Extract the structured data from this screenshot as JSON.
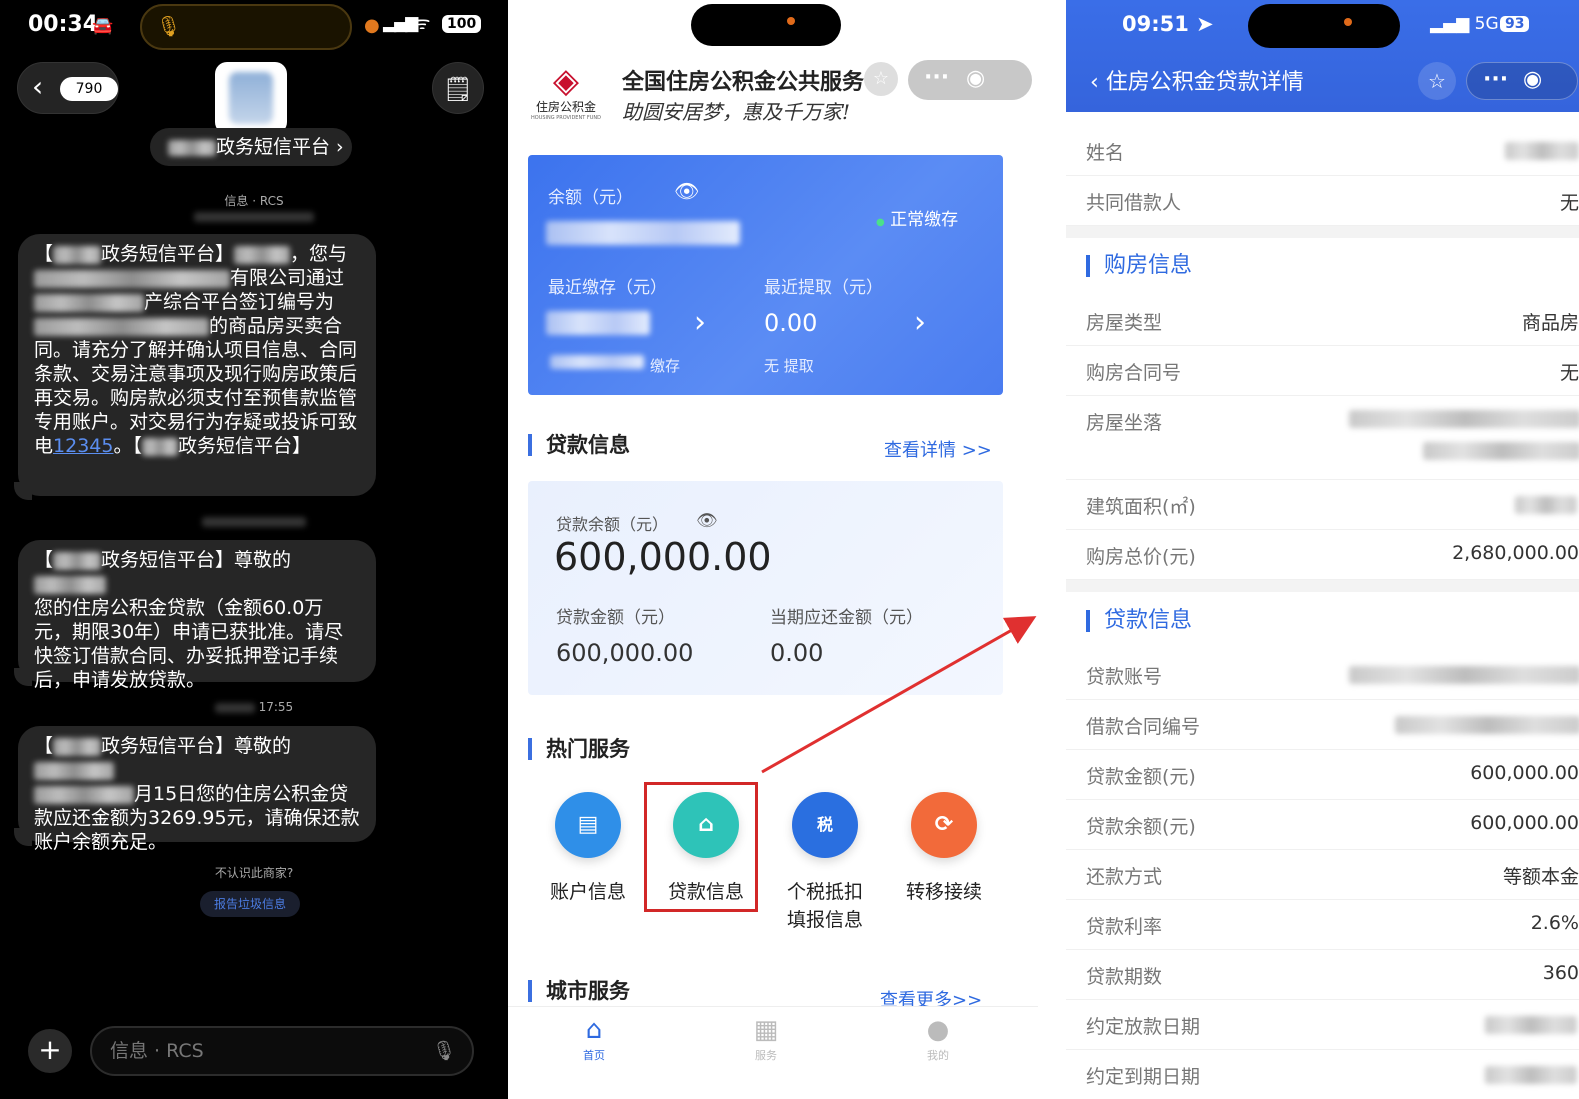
{
  "panel1": {
    "status": {
      "time": "00:34",
      "battery": "100"
    },
    "nav": {
      "back_count": "790"
    },
    "sender": {
      "name": "政务短信平台"
    },
    "meta1": "信息 · RCS",
    "msg1": {
      "p1": "【",
      "p2": "政务短信平台】",
      "p3": "，您与",
      "p4": "有限公司通过",
      "p5": "产综合平台签订编号为",
      "p6": "的商品房买卖合同。请充分了解并确认项目信息、合同条款、交易注意事项及现行购房政策后再交易。购房款必须支付至预售款监管专用账户。对交易行为存疑或投诉可致电",
      "link": "12345",
      "p7": "。【",
      "p8": "政务短信平台】"
    },
    "msg2": {
      "p1": "【",
      "p2": "政务短信平台】尊敬的",
      "p3": "您的住房公积金贷款（金额60.0万元，期限30年）申请已获批准。请尽快签订借款合同、办妥抵押登记手续后，申请发放贷款。"
    },
    "meta3": "17:55",
    "msg3": {
      "p1": "【",
      "p2": "政务短信平台】尊敬的",
      "p3": "月15日您的住房公积金贷款应还金额为3269.95元，请确保还款账户余额充足。"
    },
    "unknown_text": "不认识此商家?",
    "report_label": "报告垃圾信息",
    "input_placeholder": "信息 · RCS"
  },
  "panel2": {
    "header": {
      "title": "全国住房公积金公共服务",
      "subtitle": "助圆安居梦，惠及千万家!",
      "logo_text": "住房公积金",
      "logo_small": "HOUSING PROVIDENT FUND"
    },
    "balance": {
      "label": "余额（元）",
      "status": "正常缴存",
      "recent_deposit_label": "最近缴存（元）",
      "recent_withdraw_label": "最近提取（元）",
      "recent_withdraw_value": "0.00",
      "deposit_note": "缴存",
      "withdraw_note": "无 提取"
    },
    "loan_section": {
      "title": "贷款信息",
      "link": "查看详情 >>"
    },
    "loan": {
      "remaining_label": "贷款余额（元）",
      "remaining_value": "600,000.00",
      "amount_label": "贷款金额（元）",
      "amount_value": "600,000.00",
      "due_label": "当期应还金额（元）",
      "due_value": "0.00"
    },
    "hot_title": "热门服务",
    "services": [
      {
        "label": "账户信息",
        "icon": "account-card-icon",
        "color": "#2f8fe8"
      },
      {
        "label": "贷款信息",
        "icon": "house-card-icon",
        "color": "#2ec3b8"
      },
      {
        "label": "个税抵扣",
        "label2": "填报信息",
        "icon": "tax-icon",
        "color": "#2a6fe0"
      },
      {
        "label": "转移接续",
        "icon": "transfer-icon",
        "color": "#f26a3a"
      }
    ],
    "city": {
      "title": "城市服务",
      "link": "查看更多>>"
    },
    "tabs": [
      {
        "label": "首页",
        "icon": "home-icon",
        "active": true
      },
      {
        "label": "服务",
        "icon": "grid-icon",
        "active": false
      },
      {
        "label": "我的",
        "icon": "user-icon",
        "active": false
      }
    ]
  },
  "panel3": {
    "status": {
      "time": "09:51",
      "network": "5G",
      "battery": "93"
    },
    "title": "住房公积金贷款详情",
    "rows_top": [
      {
        "key": "姓名",
        "value": ""
      },
      {
        "key": "共同借款人",
        "value": "无"
      }
    ],
    "purchase_title": "购房信息",
    "purchase_rows": [
      {
        "key": "房屋类型",
        "value": "商品房"
      },
      {
        "key": "购房合同号",
        "value": "无"
      },
      {
        "key": "房屋坐落",
        "value": ""
      },
      {
        "key": "建筑面积(㎡)",
        "value": ""
      },
      {
        "key": "购房总价(元)",
        "value": "2,680,000.00"
      }
    ],
    "loan_title": "贷款信息",
    "loan_rows": [
      {
        "key": "贷款账号",
        "value": ""
      },
      {
        "key": "借款合同编号",
        "value": ""
      },
      {
        "key": "贷款金额(元)",
        "value": "600,000.00"
      },
      {
        "key": "贷款余额(元)",
        "value": "600,000.00"
      },
      {
        "key": "还款方式",
        "value": "等额本金"
      },
      {
        "key": "贷款利率",
        "value": "2.6%"
      },
      {
        "key": "贷款期数",
        "value": "360"
      },
      {
        "key": "约定放款日期",
        "value": ""
      },
      {
        "key": "约定到期日期",
        "value": ""
      }
    ]
  },
  "colors": {
    "accent": "#3b6fe0",
    "highlight": "#d22828",
    "imessage_bubble": "#262626"
  }
}
